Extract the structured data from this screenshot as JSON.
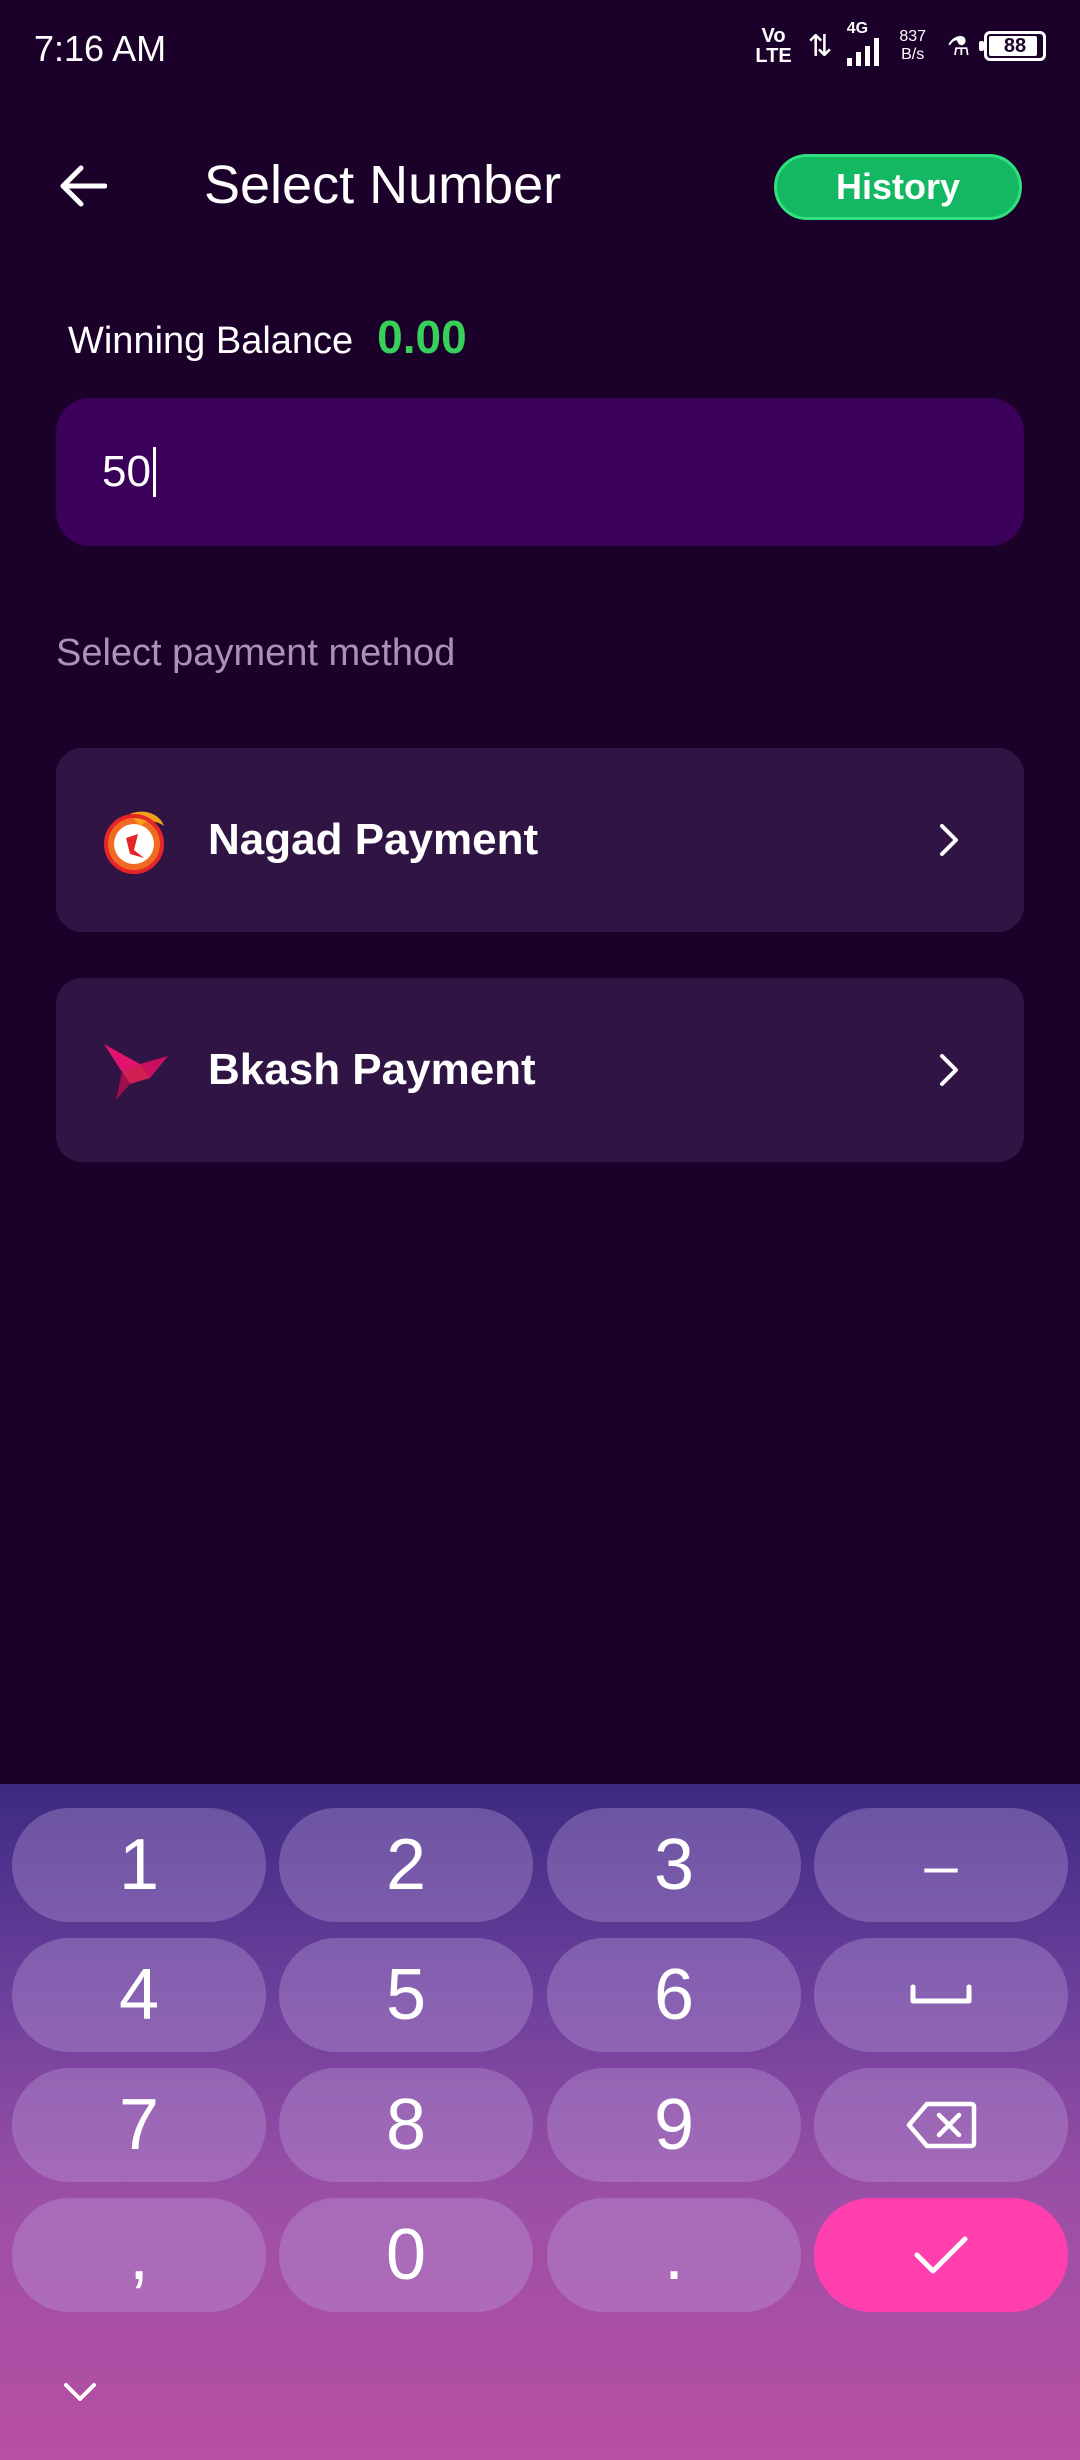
{
  "status_bar": {
    "time": "7:16 AM",
    "volte": [
      "Vo",
      "LTE"
    ],
    "network": "4G",
    "speed_value": "837",
    "speed_unit": "B/s",
    "battery": "88"
  },
  "header": {
    "title": "Select Number",
    "history_label": "History"
  },
  "balance": {
    "label": "Winning Balance",
    "value": "0.00"
  },
  "amount_input": {
    "value": "50"
  },
  "payment": {
    "heading": "Select payment method",
    "methods": [
      {
        "label": "Nagad Payment",
        "icon": "nagad-logo-icon"
      },
      {
        "label": "Bkash Payment",
        "icon": "bkash-logo-icon"
      }
    ]
  },
  "keyboard": {
    "keys": [
      "1",
      "2",
      "3",
      "–",
      "4",
      "5",
      "6",
      "␣",
      "7",
      "8",
      "9",
      "⌫",
      ",",
      "0",
      ".",
      "✓"
    ]
  },
  "colors": {
    "background": "#1b0029",
    "accent_green": "#14b862",
    "balance_green": "#37d05a",
    "input_bg": "#3a005a",
    "card_bg": "#301444",
    "enter_key": "#ff3fae"
  }
}
